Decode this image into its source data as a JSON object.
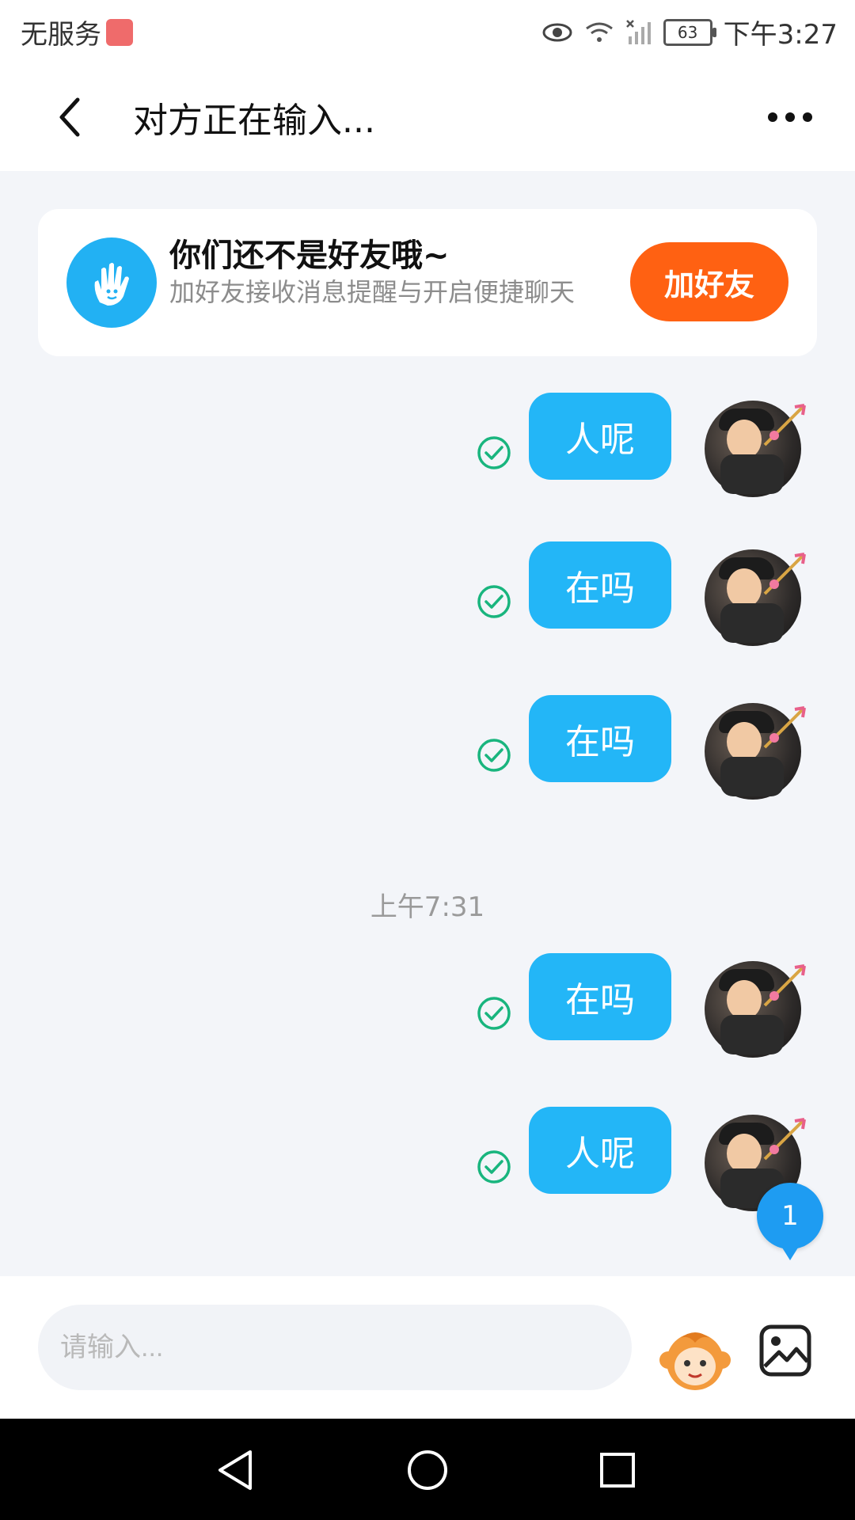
{
  "status_bar": {
    "carrier": "无服务",
    "battery": "63",
    "time": "下午3:27",
    "icons": [
      "eye-icon",
      "wifi-icon",
      "signal-off-icon",
      "battery-icon"
    ]
  },
  "header": {
    "title": "对方正在输入...",
    "back_icon": "chevron-left-icon",
    "more_icon": "more-dots-icon"
  },
  "banner": {
    "title": "你们还不是好友哦~",
    "subtitle": "加好友接收消息提醒与开启便捷聊天",
    "button": "加好友",
    "icon": "hand-wave-icon",
    "accent": "#ff6112"
  },
  "messages": [
    {
      "text": "人呢",
      "status_icon": "sent-check-icon"
    },
    {
      "text": "在吗",
      "status_icon": "sent-check-icon"
    },
    {
      "text": "在吗",
      "status_icon": "sent-check-icon"
    },
    {
      "text": "在吗",
      "status_icon": "sent-check-icon"
    },
    {
      "text": "人呢",
      "status_icon": "sent-check-icon"
    }
  ],
  "time_label": "上午7:31",
  "unread_badge": "1",
  "input": {
    "placeholder": "请输入...",
    "value": ""
  },
  "actions": {
    "emoji_icon": "monkey-emoji-icon",
    "image_icon": "image-icon"
  },
  "nav_bar": [
    "nav-back-icon",
    "nav-home-icon",
    "nav-recent-icon"
  ],
  "colors": {
    "bubble": "#23b6f7",
    "check": "#19b57e",
    "background": "#f3f5f9"
  }
}
